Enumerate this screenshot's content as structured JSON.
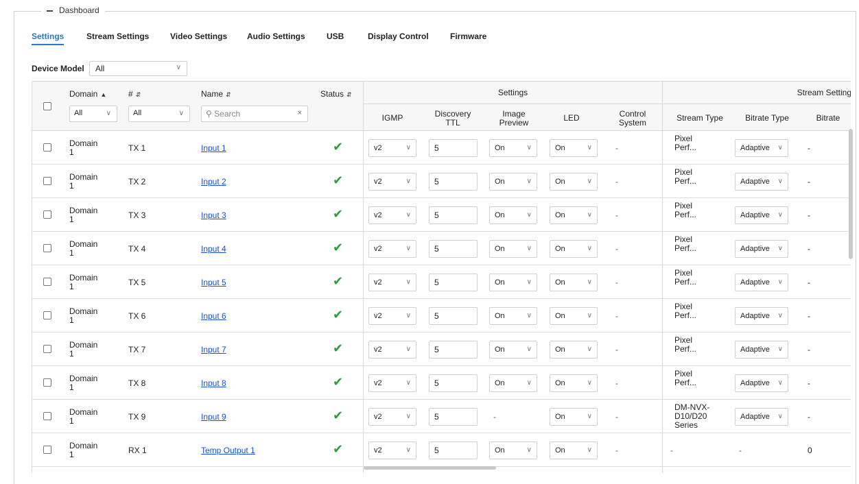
{
  "dashboard": {
    "title": "Dashboard"
  },
  "tabs": [
    {
      "label": "Settings"
    },
    {
      "label": "Stream Settings"
    },
    {
      "label": "Video Settings"
    },
    {
      "label": "Audio Settings"
    },
    {
      "label": "USB"
    },
    {
      "label": "Display Control"
    },
    {
      "label": "Firmware"
    }
  ],
  "device_model": {
    "label": "Device Model",
    "value": "All"
  },
  "table": {
    "headers": {
      "domain": "Domain",
      "number": "#",
      "name": "Name",
      "status": "Status",
      "settings_group": "Settings",
      "stream_group": "Stream Setting",
      "igmp": "IGMP",
      "discovery_ttl": "Discovery TTL",
      "image_preview": "Image Preview",
      "led": "LED",
      "control_system": "Control System",
      "stream_type": "Stream Type",
      "bitrate_type": "Bitrate Type",
      "bitrate": "Bitrate"
    },
    "filters": {
      "domain": "All",
      "number": "All",
      "search_placeholder": "Search"
    },
    "rows": [
      {
        "domain": "Domain 1",
        "num": "TX 1",
        "name": "Input 1",
        "igmp": "v2",
        "ttl": "5",
        "preview": "On",
        "led": "On",
        "ctrl": "-",
        "stream_type": "Pixel Perf...",
        "bitrate_type": "Adaptive",
        "bitrate": "-"
      },
      {
        "domain": "Domain 1",
        "num": "TX 2",
        "name": "Input 2",
        "igmp": "v2",
        "ttl": "5",
        "preview": "On",
        "led": "On",
        "ctrl": "-",
        "stream_type": "Pixel Perf...",
        "bitrate_type": "Adaptive",
        "bitrate": "-"
      },
      {
        "domain": "Domain 1",
        "num": "TX 3",
        "name": "Input 3",
        "igmp": "v2",
        "ttl": "5",
        "preview": "On",
        "led": "On",
        "ctrl": "-",
        "stream_type": "Pixel Perf...",
        "bitrate_type": "Adaptive",
        "bitrate": "-"
      },
      {
        "domain": "Domain 1",
        "num": "TX 4",
        "name": "Input 4",
        "igmp": "v2",
        "ttl": "5",
        "preview": "On",
        "led": "On",
        "ctrl": "-",
        "stream_type": "Pixel Perf...",
        "bitrate_type": "Adaptive",
        "bitrate": "-"
      },
      {
        "domain": "Domain 1",
        "num": "TX 5",
        "name": "Input 5",
        "igmp": "v2",
        "ttl": "5",
        "preview": "On",
        "led": "On",
        "ctrl": "-",
        "stream_type": "Pixel Perf...",
        "bitrate_type": "Adaptive",
        "bitrate": "-"
      },
      {
        "domain": "Domain 1",
        "num": "TX 6",
        "name": "Input 6",
        "igmp": "v2",
        "ttl": "5",
        "preview": "On",
        "led": "On",
        "ctrl": "-",
        "stream_type": "Pixel Perf...",
        "bitrate_type": "Adaptive",
        "bitrate": "-"
      },
      {
        "domain": "Domain 1",
        "num": "TX 7",
        "name": "Input 7",
        "igmp": "v2",
        "ttl": "5",
        "preview": "On",
        "led": "On",
        "ctrl": "-",
        "stream_type": "Pixel Perf...",
        "bitrate_type": "Adaptive",
        "bitrate": "-"
      },
      {
        "domain": "Domain 1",
        "num": "TX 8",
        "name": "Input 8",
        "igmp": "v2",
        "ttl": "5",
        "preview": "On",
        "led": "On",
        "ctrl": "-",
        "stream_type": "Pixel Perf...",
        "bitrate_type": "Adaptive",
        "bitrate": "-"
      },
      {
        "domain": "Domain 1",
        "num": "TX 9",
        "name": "Input 9",
        "igmp": "v2",
        "ttl": "5",
        "preview": "-",
        "led": "On",
        "ctrl": "-",
        "stream_type": "DM-NVX-D10/D20 Series",
        "bitrate_type": "Adaptive",
        "bitrate": "-"
      },
      {
        "domain": "Domain 1",
        "num": "RX 1",
        "name": "Temp Output 1",
        "igmp": "v2",
        "ttl": "5",
        "preview": "On",
        "led": "On",
        "ctrl": "-",
        "stream_type": "-",
        "bitrate_type": "-",
        "bitrate": "0"
      }
    ]
  },
  "colors": {
    "accent": "#2a78c6",
    "link": "#1a4fd6",
    "status_ok": "#2e9e3a"
  },
  "icons": {
    "status": "check-icon",
    "dropdown": "chevron-down-icon",
    "search": "search-icon",
    "clear": "close-icon"
  }
}
